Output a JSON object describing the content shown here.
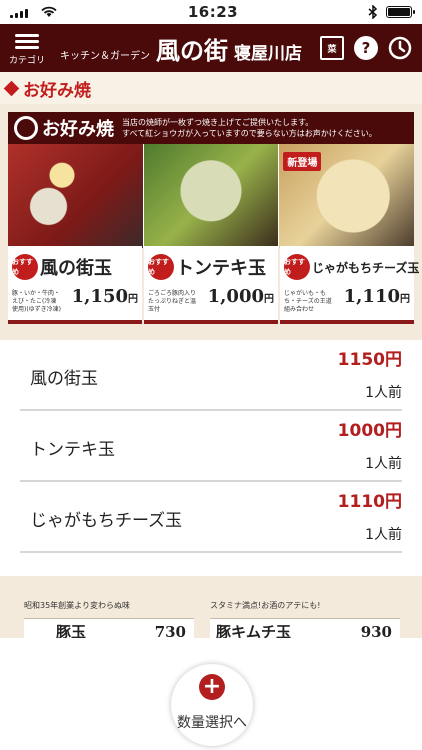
{
  "status_bar": {
    "time": "16:23"
  },
  "header": {
    "category_label": "カテゴリ",
    "brand_sub": "キッチン＆ガーデン",
    "brand_logo": "風の街",
    "store": "寝屋川店",
    "menu_icon_text": "菜"
  },
  "section": {
    "title": "お好み焼"
  },
  "banner": {
    "title": "お好み焼",
    "desc_1": "当店の焼師が一枚ずつ焼き上げてご提供いたします。",
    "desc_2": "すべて紅ショウガが入っていますので要らない方はお声かけください。",
    "new_badge": "新登場",
    "osusume": "おすすめ",
    "cards": [
      {
        "name": "風の街玉",
        "desc": "豚・いか・牛肉・えび・たこ(冷凍使用)(ゆずき冷凍)",
        "price": "1,150",
        "yen": "円"
      },
      {
        "name": "トンテキ玉",
        "desc": "ごろごろ豚肉入りたっぷりねぎと温玉付",
        "price": "1,000",
        "yen": "円"
      },
      {
        "name": "じゃがもちチーズ玉",
        "desc": "じゃがいも・もち・チーズの王道組み合わせ",
        "price": "1,110",
        "yen": "円"
      }
    ]
  },
  "menu_items": [
    {
      "name": "風の街玉",
      "price": "1150円",
      "qty": "1人前"
    },
    {
      "name": "トンテキ玉",
      "price": "1000円",
      "qty": "1人前"
    },
    {
      "name": "じゃがもちチーズ玉",
      "price": "1110円",
      "qty": "1人前"
    }
  ],
  "bottom_banner": {
    "left_sub": "昭和35年創業より変わらぬ味",
    "left_name": "豚玉",
    "left_price": "730",
    "right_sub": "スタミナ満点!お酒のアテにも!",
    "right_name": "豚キムチ玉",
    "right_price": "930"
  },
  "quantity_button": {
    "label": "数量選択へ"
  },
  "colors": {
    "header_bg": "#4a0a0a",
    "accent_red": "#b31e1e",
    "title_red": "#c21d1d"
  }
}
